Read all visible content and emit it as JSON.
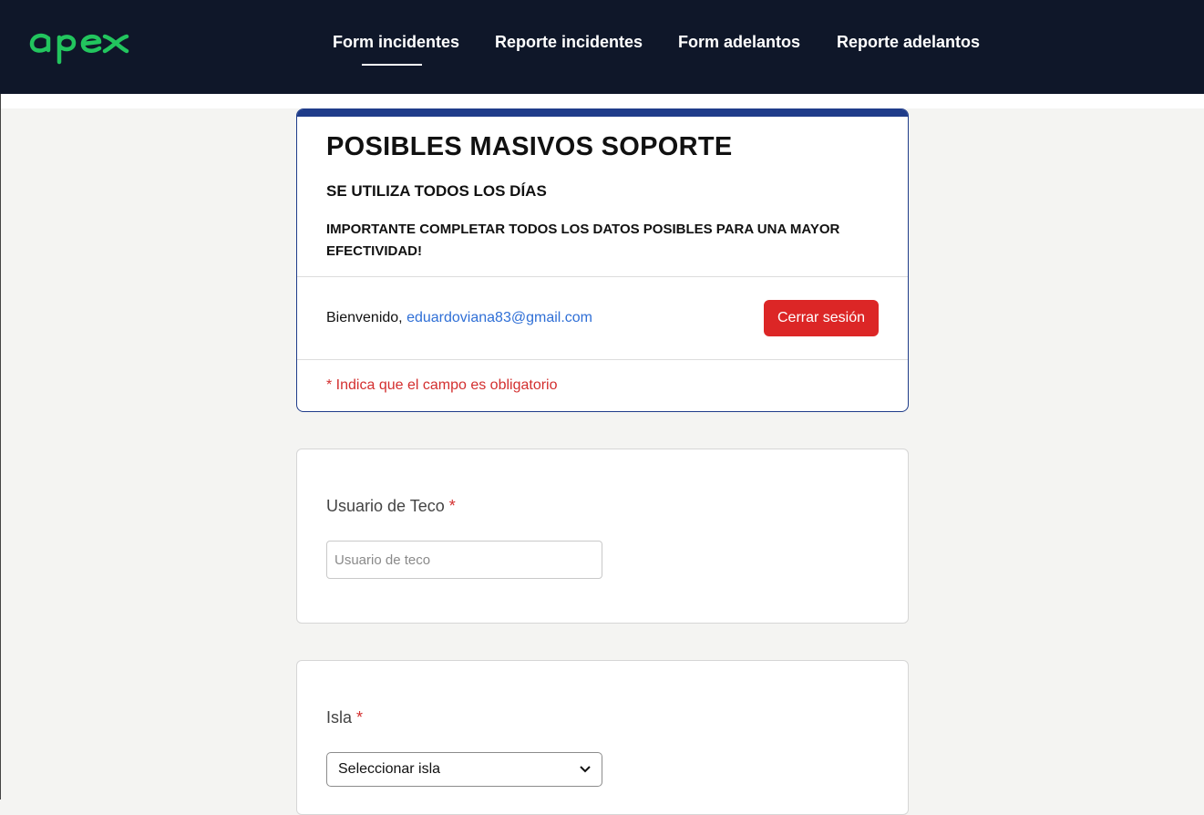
{
  "brand": {
    "logo_text": "apex",
    "color": "#22c55e"
  },
  "nav": {
    "items": [
      {
        "label": "Form incidentes",
        "active": true
      },
      {
        "label": "Reporte incidentes",
        "active": false
      },
      {
        "label": "Form adelantos",
        "active": false
      },
      {
        "label": "Reporte adelantos",
        "active": false
      }
    ]
  },
  "header": {
    "title": "POSIBLES MASIVOS SOPORTE",
    "subtitle": "SE UTILIZA TODOS LOS DÍAS",
    "important": "IMPORTANTE COMPLETAR TODOS LOS DATOS POSIBLES PARA UNA MAYOR EFECTIVIDAD!",
    "welcome_prefix": "Bienvenido,",
    "user_email": "eduardoviana83@gmail.com",
    "logout_label": "Cerrar sesión",
    "required_note": "* Indica que el campo es obligatorio"
  },
  "fields": {
    "usuario": {
      "label": "Usuario de Teco",
      "required_mark": "*",
      "placeholder": "Usuario de teco",
      "value": ""
    },
    "isla": {
      "label": "Isla",
      "required_mark": "*",
      "selected": "Seleccionar isla"
    }
  },
  "colors": {
    "navbar_bg": "#0f1729",
    "accent_blue": "#1f3c8a",
    "danger": "#dc2626",
    "link": "#2f6fd6",
    "required": "#d32f2f"
  }
}
